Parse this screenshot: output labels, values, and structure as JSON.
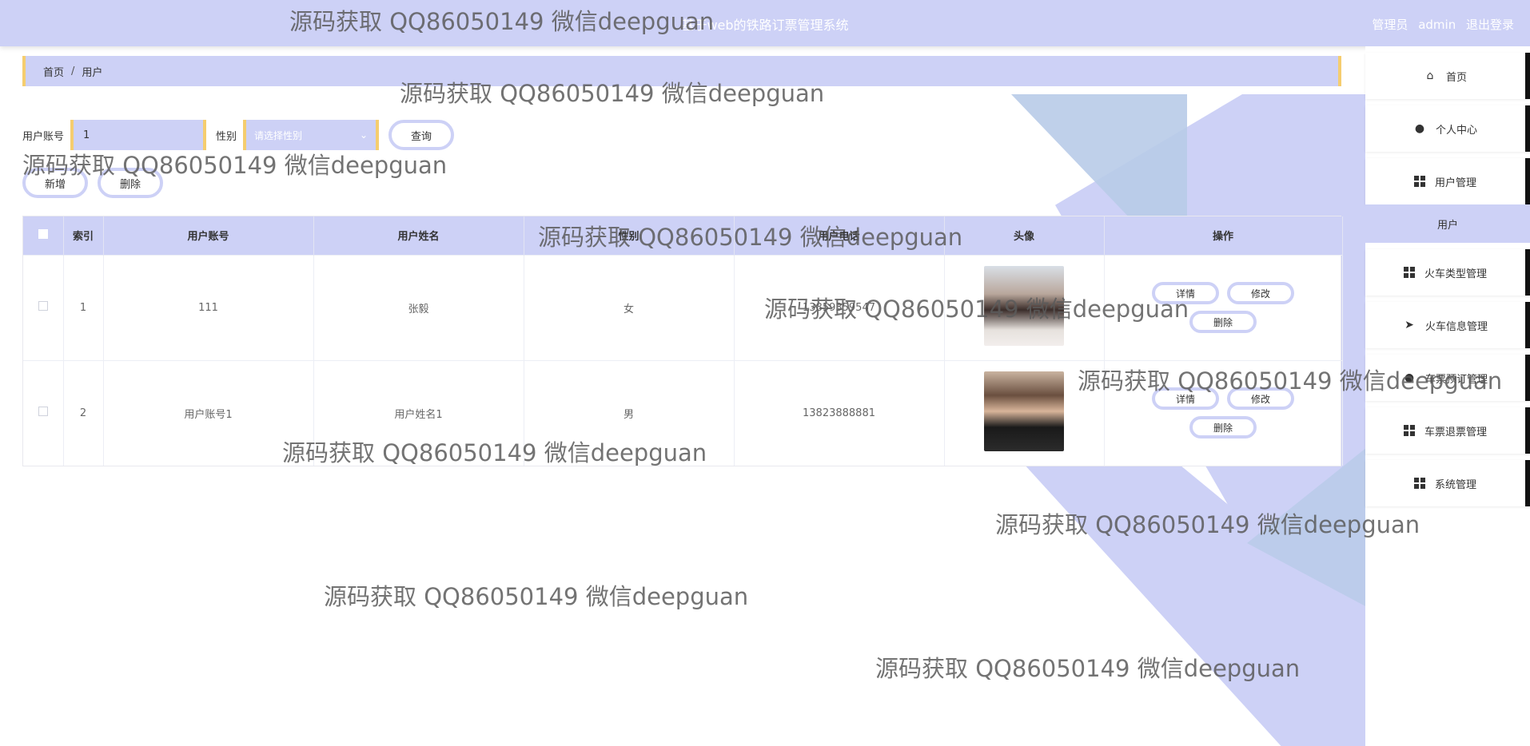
{
  "header": {
    "title": "基于web的铁路订票管理系统",
    "role": "管理员",
    "username": "admin",
    "logout": "退出登录"
  },
  "breadcrumb": {
    "home": "首页",
    "separator": "/",
    "current": "用户"
  },
  "search": {
    "account_label": "用户账号",
    "account_value": "1",
    "gender_label": "性别",
    "gender_placeholder": "请选择性别",
    "query_button": "查询"
  },
  "actions": {
    "add": "新增",
    "delete": "删除"
  },
  "table": {
    "headers": [
      "索引",
      "用户账号",
      "用户姓名",
      "性别",
      "用户电话",
      "头像",
      "操作"
    ],
    "rows": [
      {
        "index": "1",
        "account": "111",
        "name": "张毅",
        "gender": "女",
        "phone": "13859359547"
      },
      {
        "index": "2",
        "account": "用户账号1",
        "name": "用户姓名1",
        "gender": "男",
        "phone": "13823888881"
      }
    ],
    "op_detail": "详情",
    "op_edit": "修改",
    "op_delete": "删除"
  },
  "sidebar": {
    "items": [
      {
        "label": "首页",
        "icon": "home-icon"
      },
      {
        "label": "个人中心",
        "icon": "user-icon"
      },
      {
        "label": "用户管理",
        "icon": "grid-icon"
      },
      {
        "label": "用户",
        "icon": ""
      },
      {
        "label": "火车类型管理",
        "icon": "grid-icon"
      },
      {
        "label": "火车信息管理",
        "icon": "send-icon"
      },
      {
        "label": "车票预订管理",
        "icon": "user-icon"
      },
      {
        "label": "车票退票管理",
        "icon": "grid-icon"
      },
      {
        "label": "系统管理",
        "icon": "grid-icon"
      }
    ]
  },
  "watermark": "源码获取 QQ86050149 微信deepguan",
  "colors": {
    "accent": "#cdd1f6",
    "border_accent": "#f5cd6f",
    "light_blue": "#b8cbe8"
  }
}
